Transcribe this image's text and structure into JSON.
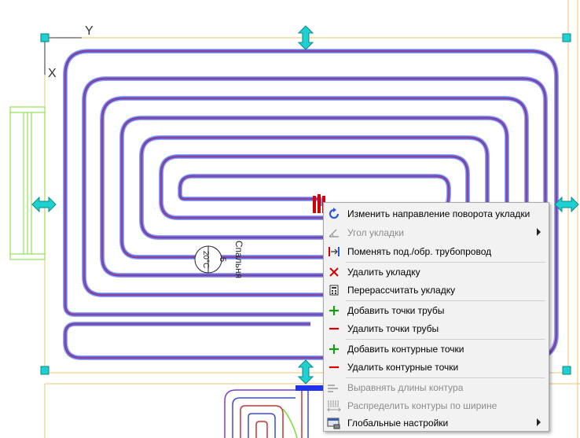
{
  "drawing": {
    "axis_y": "Y",
    "axis_x": "X",
    "room_label_vertical": "Спальня",
    "room_tag_top": "5",
    "room_tag_bottom": "20°C"
  },
  "colors": {
    "pipe_outer": "#3b4bdc",
    "pipe_inner": "#ff3a3a",
    "grip": "#1fd0d0",
    "room_border": "#f2c36b",
    "wall_green": "#7ddc3a"
  },
  "context_menu": {
    "items": [
      {
        "label": "Изменить направление поворота укладки",
        "icon": "rotate-arrow-icon",
        "disabled": false,
        "submenu": false
      },
      {
        "label": "Угол укладки",
        "icon": "angle-icon",
        "disabled": true,
        "submenu": true
      },
      {
        "label": "Поменять под./обр. трубопровод",
        "icon": "swap-pipes-icon",
        "disabled": false,
        "submenu": false
      },
      {
        "label": "Удалить укладку",
        "icon": "red-cross-icon",
        "disabled": false,
        "submenu": false
      },
      {
        "label": "Перерассчитать укладку",
        "icon": "calculator-icon",
        "disabled": false,
        "submenu": false
      },
      {
        "label": "Добавить точки трубы",
        "icon": "green-plus-icon",
        "disabled": false,
        "submenu": false
      },
      {
        "label": "Удалить точки трубы",
        "icon": "red-minus-icon",
        "disabled": false,
        "submenu": false
      },
      {
        "label": "Добавить контурные точки",
        "icon": "green-plus-icon",
        "disabled": false,
        "submenu": false
      },
      {
        "label": "Удалить контурные точки",
        "icon": "red-minus-icon",
        "disabled": false,
        "submenu": false
      },
      {
        "label": "Выравнять длины контура",
        "icon": "align-lengths-icon",
        "disabled": true,
        "submenu": false
      },
      {
        "label": "Распределить контуры по ширине",
        "icon": "distribute-width-icon",
        "disabled": true,
        "submenu": false
      },
      {
        "label": "Глобальные настройки",
        "icon": "global-settings-icon",
        "disabled": false,
        "submenu": true
      }
    ]
  }
}
